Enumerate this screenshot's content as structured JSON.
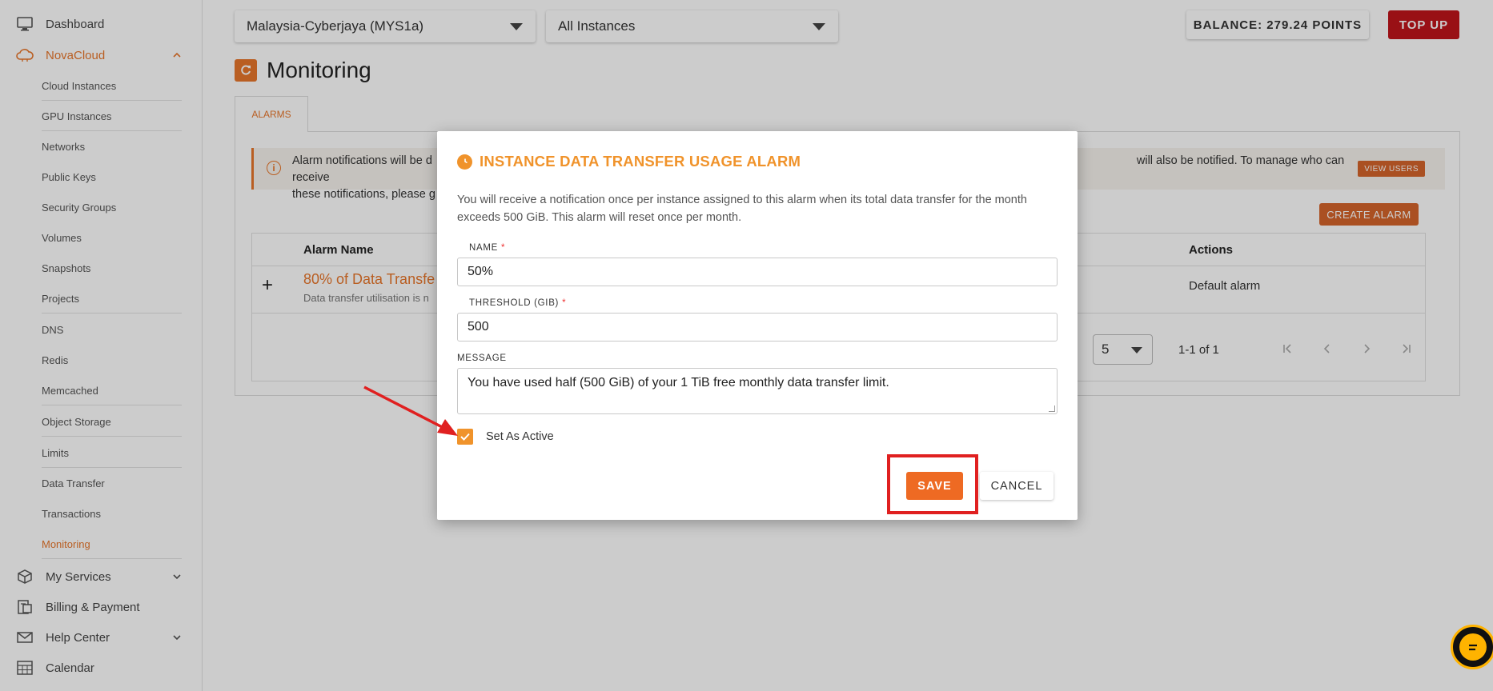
{
  "sidebar": {
    "top_items": [
      {
        "label": "Dashboard",
        "icon": "monitor-icon"
      },
      {
        "label": "NovaCloud",
        "icon": "cloud-icon"
      },
      {
        "label": "My Services",
        "icon": "box-icon"
      },
      {
        "label": "Billing & Payment",
        "icon": "billing-icon"
      },
      {
        "label": "Help Center",
        "icon": "mail-icon"
      },
      {
        "label": "Calendar",
        "icon": "calendar-icon"
      }
    ],
    "sub_items": [
      "Cloud Instances",
      "GPU Instances",
      "Networks",
      "Public Keys",
      "Security Groups",
      "Volumes",
      "Snapshots",
      "Projects",
      "DNS",
      "Redis",
      "Memcached",
      "Object Storage",
      "Limits",
      "Data Transfer",
      "Transactions",
      "Monitoring"
    ],
    "active_item": "Monitoring"
  },
  "topbar": {
    "region": "Malaysia-Cyberjaya (MYS1a)",
    "instance_filter": "All Instances",
    "balance": "BALANCE: 279.24 POINTS",
    "topup": "TOP UP"
  },
  "page": {
    "title": "Monitoring",
    "tab": "ALARMS",
    "info_text": "Alarm notifications will be d                                                                                                                                                                           will also be notified. To manage who can receive these notifications, please g",
    "info_line1_left": "Alarm notifications will be d",
    "info_line1_right": "will also be notified. To manage who can receive",
    "info_line2": "these notifications, please g",
    "view_users": "VIEW USERS",
    "create_alarm": "CREATE ALARM",
    "table": {
      "headers": [
        "Alarm Name",
        "Actions"
      ],
      "rows": [
        {
          "name": "80% of Data Transfe",
          "desc": "Data transfer utilisation is n",
          "action": "Default alarm"
        }
      ]
    },
    "pagination": {
      "rows_per_page": "5",
      "range": "1-1 of 1"
    }
  },
  "modal": {
    "title": "INSTANCE DATA TRANSFER USAGE ALARM",
    "description": "You will receive a notification once per instance assigned to this alarm when its total data transfer for the month exceeds 500 GiB. This alarm will reset once per month.",
    "name_label": "NAME",
    "name_value": "50%",
    "threshold_label": "THRESHOLD (GIB)",
    "threshold_value": "500",
    "message_label": "MESSAGE",
    "message_value": "You have used half (500 GiB) of your 1 TiB free monthly data transfer limit.",
    "required_marker": "*",
    "active_label": "Set As Active",
    "active_checked": true,
    "save": "SAVE",
    "cancel": "CANCEL"
  },
  "colors": {
    "accent": "#e8762b",
    "modal_accent": "#f0932b",
    "topup": "#c0151b",
    "highlight": "#e02020"
  }
}
